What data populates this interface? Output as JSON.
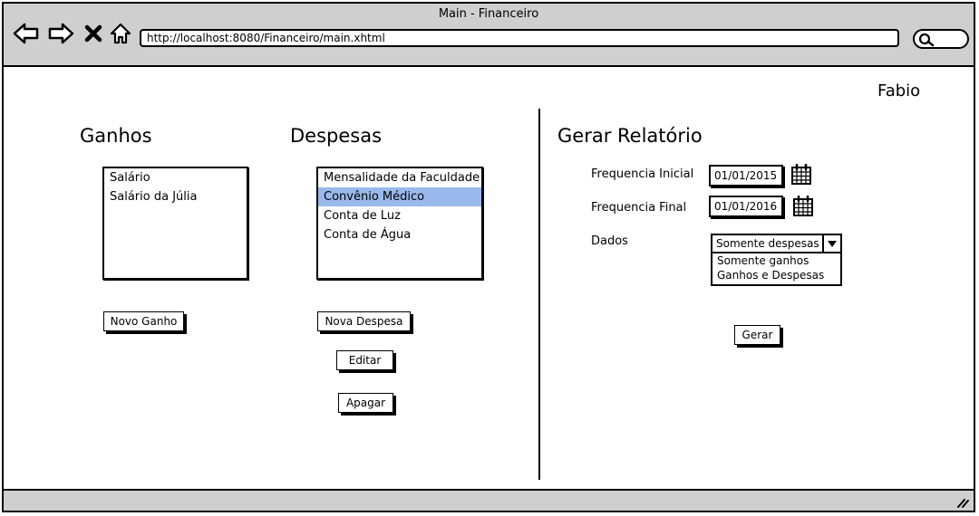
{
  "window": {
    "title": "Main - Financeiro",
    "url": "http://localhost:8080/Financeiro/main.xhtml"
  },
  "user": {
    "name": "Fabio"
  },
  "ganhos": {
    "heading": "Ganhos",
    "items": [
      {
        "label": "Salário"
      },
      {
        "label": "Salário da Júlia"
      }
    ],
    "new_button": "Novo Ganho"
  },
  "despesas": {
    "heading": "Despesas",
    "items": [
      {
        "label": "Mensalidade da Faculdade",
        "selected": false
      },
      {
        "label": "Convênio Médico",
        "selected": true
      },
      {
        "label": "Conta de Luz",
        "selected": false
      },
      {
        "label": "Conta de Água",
        "selected": false
      }
    ],
    "new_button": "Nova Despesa",
    "edit_button": "Editar",
    "delete_button": "Apagar"
  },
  "relatorio": {
    "heading": "Gerar Relatório",
    "start_label": "Frequencia Inicial",
    "start_value": "01/01/2015",
    "end_label": "Frequencia Final",
    "end_value": "01/01/2016",
    "data_label": "Dados",
    "data_selected": "Somente despesas",
    "data_options": [
      "Somente ganhos",
      "Ganhos e Despesas"
    ],
    "generate_button": "Gerar"
  },
  "colors": {
    "chrome": "#cfcfcf",
    "selection": "#99b9ec"
  },
  "icons": [
    "back-arrow-icon",
    "forward-arrow-icon",
    "stop-icon",
    "home-icon",
    "search-icon",
    "calendar-icon",
    "dropdown-arrow-icon",
    "resize-grip-icon"
  ]
}
